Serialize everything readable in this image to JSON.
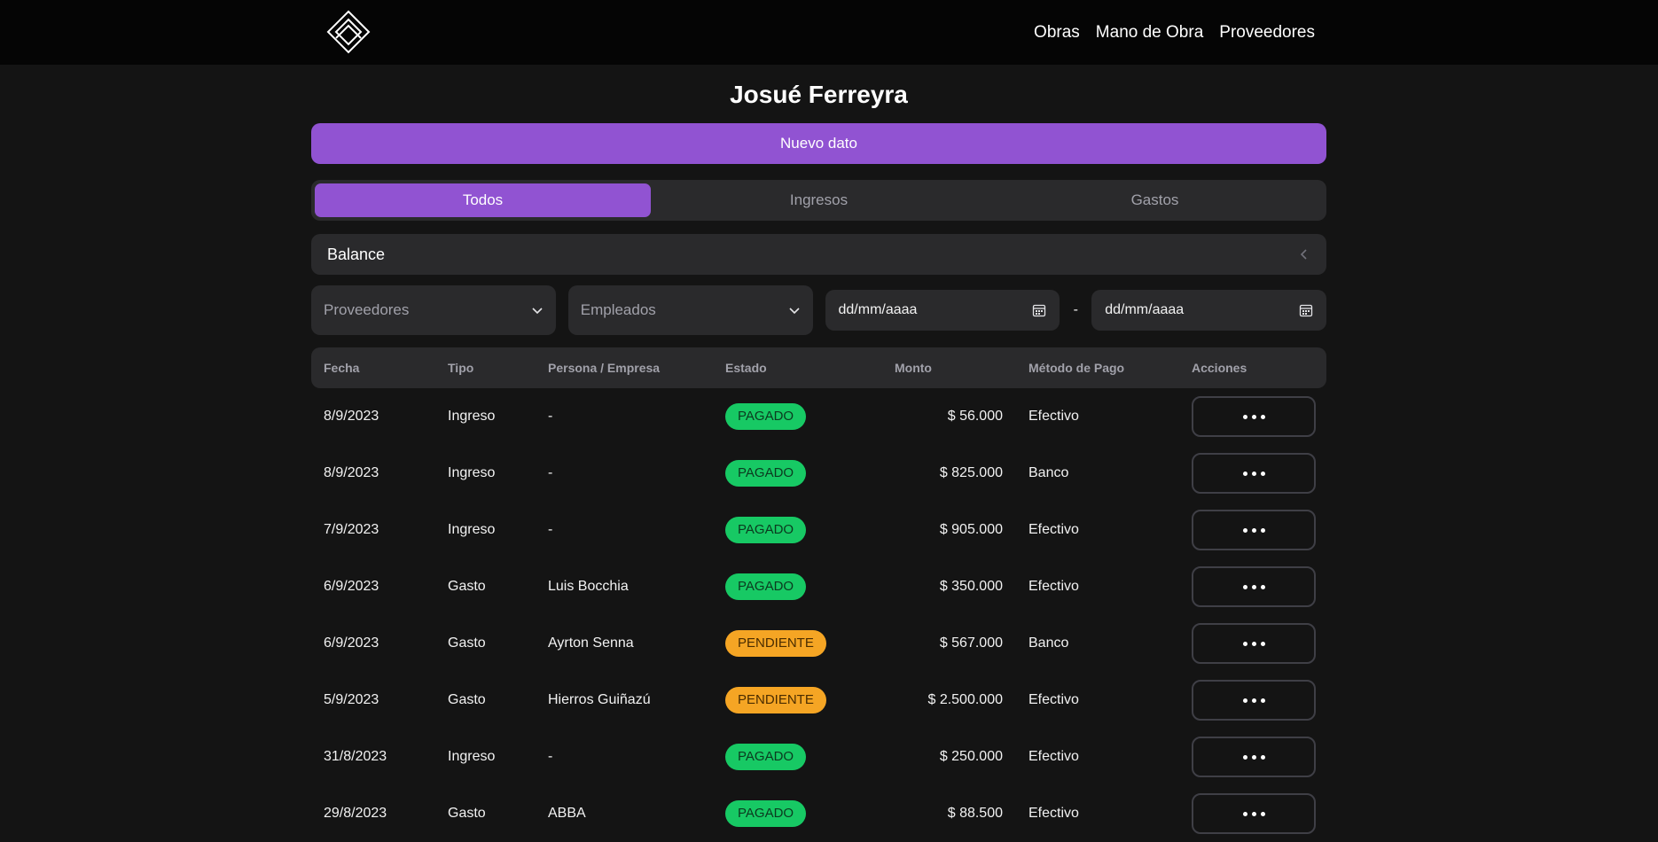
{
  "nav": {
    "links": [
      "Obras",
      "Mano de Obra",
      "Proveedores"
    ]
  },
  "page": {
    "title": "Josué Ferreyra",
    "new_button": "Nuevo dato"
  },
  "tabs": [
    {
      "label": "Todos",
      "active": true
    },
    {
      "label": "Ingresos",
      "active": false
    },
    {
      "label": "Gastos",
      "active": false
    }
  ],
  "accordion": {
    "title": "Balance"
  },
  "filters": {
    "proveedores": "Proveedores",
    "empleados": "Empleados",
    "date_from": "dd/mm/aaaa",
    "separator": "-",
    "date_to": "dd/mm/aaaa"
  },
  "table": {
    "headers": [
      "Fecha",
      "Tipo",
      "Persona / Empresa",
      "Estado",
      "Monto",
      "Método de Pago",
      "Acciones"
    ],
    "rows": [
      {
        "fecha": "8/9/2023",
        "tipo": "Ingreso",
        "persona": "-",
        "estado": "PAGADO",
        "monto": "$ 56.000",
        "metodo": "Efectivo"
      },
      {
        "fecha": "8/9/2023",
        "tipo": "Ingreso",
        "persona": "-",
        "estado": "PAGADO",
        "monto": "$ 825.000",
        "metodo": "Banco"
      },
      {
        "fecha": "7/9/2023",
        "tipo": "Ingreso",
        "persona": "-",
        "estado": "PAGADO",
        "monto": "$ 905.000",
        "metodo": "Efectivo"
      },
      {
        "fecha": "6/9/2023",
        "tipo": "Gasto",
        "persona": "Luis Bocchia",
        "estado": "PAGADO",
        "monto": "$ 350.000",
        "metodo": "Efectivo"
      },
      {
        "fecha": "6/9/2023",
        "tipo": "Gasto",
        "persona": "Ayrton Senna",
        "estado": "PENDIENTE",
        "monto": "$ 567.000",
        "metodo": "Banco"
      },
      {
        "fecha": "5/9/2023",
        "tipo": "Gasto",
        "persona": "Hierros Guiñazú",
        "estado": "PENDIENTE",
        "monto": "$ 2.500.000",
        "metodo": "Efectivo"
      },
      {
        "fecha": "31/8/2023",
        "tipo": "Ingreso",
        "persona": "-",
        "estado": "PAGADO",
        "monto": "$ 250.000",
        "metodo": "Efectivo"
      },
      {
        "fecha": "29/8/2023",
        "tipo": "Gasto",
        "persona": "ABBA",
        "estado": "PAGADO",
        "monto": "$ 88.500",
        "metodo": "Efectivo"
      }
    ]
  },
  "colors": {
    "accent": "#9153d2",
    "pagado": "#17c964",
    "pendiente": "#f5a524",
    "background": "#141414",
    "surface": "#2a2a2c"
  }
}
